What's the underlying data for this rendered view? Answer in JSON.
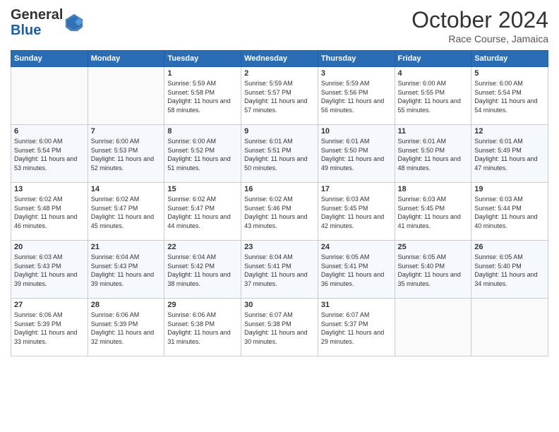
{
  "header": {
    "logo_line1": "General",
    "logo_line2": "Blue",
    "month": "October 2024",
    "location": "Race Course, Jamaica"
  },
  "weekdays": [
    "Sunday",
    "Monday",
    "Tuesday",
    "Wednesday",
    "Thursday",
    "Friday",
    "Saturday"
  ],
  "weeks": [
    [
      {
        "day": "",
        "text": ""
      },
      {
        "day": "",
        "text": ""
      },
      {
        "day": "1",
        "text": "Sunrise: 5:59 AM\nSunset: 5:58 PM\nDaylight: 11 hours and 58 minutes."
      },
      {
        "day": "2",
        "text": "Sunrise: 5:59 AM\nSunset: 5:57 PM\nDaylight: 11 hours and 57 minutes."
      },
      {
        "day": "3",
        "text": "Sunrise: 5:59 AM\nSunset: 5:56 PM\nDaylight: 11 hours and 56 minutes."
      },
      {
        "day": "4",
        "text": "Sunrise: 6:00 AM\nSunset: 5:55 PM\nDaylight: 11 hours and 55 minutes."
      },
      {
        "day": "5",
        "text": "Sunrise: 6:00 AM\nSunset: 5:54 PM\nDaylight: 11 hours and 54 minutes."
      }
    ],
    [
      {
        "day": "6",
        "text": "Sunrise: 6:00 AM\nSunset: 5:54 PM\nDaylight: 11 hours and 53 minutes."
      },
      {
        "day": "7",
        "text": "Sunrise: 6:00 AM\nSunset: 5:53 PM\nDaylight: 11 hours and 52 minutes."
      },
      {
        "day": "8",
        "text": "Sunrise: 6:00 AM\nSunset: 5:52 PM\nDaylight: 11 hours and 51 minutes."
      },
      {
        "day": "9",
        "text": "Sunrise: 6:01 AM\nSunset: 5:51 PM\nDaylight: 11 hours and 50 minutes."
      },
      {
        "day": "10",
        "text": "Sunrise: 6:01 AM\nSunset: 5:50 PM\nDaylight: 11 hours and 49 minutes."
      },
      {
        "day": "11",
        "text": "Sunrise: 6:01 AM\nSunset: 5:50 PM\nDaylight: 11 hours and 48 minutes."
      },
      {
        "day": "12",
        "text": "Sunrise: 6:01 AM\nSunset: 5:49 PM\nDaylight: 11 hours and 47 minutes."
      }
    ],
    [
      {
        "day": "13",
        "text": "Sunrise: 6:02 AM\nSunset: 5:48 PM\nDaylight: 11 hours and 46 minutes."
      },
      {
        "day": "14",
        "text": "Sunrise: 6:02 AM\nSunset: 5:47 PM\nDaylight: 11 hours and 45 minutes."
      },
      {
        "day": "15",
        "text": "Sunrise: 6:02 AM\nSunset: 5:47 PM\nDaylight: 11 hours and 44 minutes."
      },
      {
        "day": "16",
        "text": "Sunrise: 6:02 AM\nSunset: 5:46 PM\nDaylight: 11 hours and 43 minutes."
      },
      {
        "day": "17",
        "text": "Sunrise: 6:03 AM\nSunset: 5:45 PM\nDaylight: 11 hours and 42 minutes."
      },
      {
        "day": "18",
        "text": "Sunrise: 6:03 AM\nSunset: 5:45 PM\nDaylight: 11 hours and 41 minutes."
      },
      {
        "day": "19",
        "text": "Sunrise: 6:03 AM\nSunset: 5:44 PM\nDaylight: 11 hours and 40 minutes."
      }
    ],
    [
      {
        "day": "20",
        "text": "Sunrise: 6:03 AM\nSunset: 5:43 PM\nDaylight: 11 hours and 39 minutes."
      },
      {
        "day": "21",
        "text": "Sunrise: 6:04 AM\nSunset: 5:43 PM\nDaylight: 11 hours and 39 minutes."
      },
      {
        "day": "22",
        "text": "Sunrise: 6:04 AM\nSunset: 5:42 PM\nDaylight: 11 hours and 38 minutes."
      },
      {
        "day": "23",
        "text": "Sunrise: 6:04 AM\nSunset: 5:41 PM\nDaylight: 11 hours and 37 minutes."
      },
      {
        "day": "24",
        "text": "Sunrise: 6:05 AM\nSunset: 5:41 PM\nDaylight: 11 hours and 36 minutes."
      },
      {
        "day": "25",
        "text": "Sunrise: 6:05 AM\nSunset: 5:40 PM\nDaylight: 11 hours and 35 minutes."
      },
      {
        "day": "26",
        "text": "Sunrise: 6:05 AM\nSunset: 5:40 PM\nDaylight: 11 hours and 34 minutes."
      }
    ],
    [
      {
        "day": "27",
        "text": "Sunrise: 6:06 AM\nSunset: 5:39 PM\nDaylight: 11 hours and 33 minutes."
      },
      {
        "day": "28",
        "text": "Sunrise: 6:06 AM\nSunset: 5:39 PM\nDaylight: 11 hours and 32 minutes."
      },
      {
        "day": "29",
        "text": "Sunrise: 6:06 AM\nSunset: 5:38 PM\nDaylight: 11 hours and 31 minutes."
      },
      {
        "day": "30",
        "text": "Sunrise: 6:07 AM\nSunset: 5:38 PM\nDaylight: 11 hours and 30 minutes."
      },
      {
        "day": "31",
        "text": "Sunrise: 6:07 AM\nSunset: 5:37 PM\nDaylight: 11 hours and 29 minutes."
      },
      {
        "day": "",
        "text": ""
      },
      {
        "day": "",
        "text": ""
      }
    ]
  ]
}
